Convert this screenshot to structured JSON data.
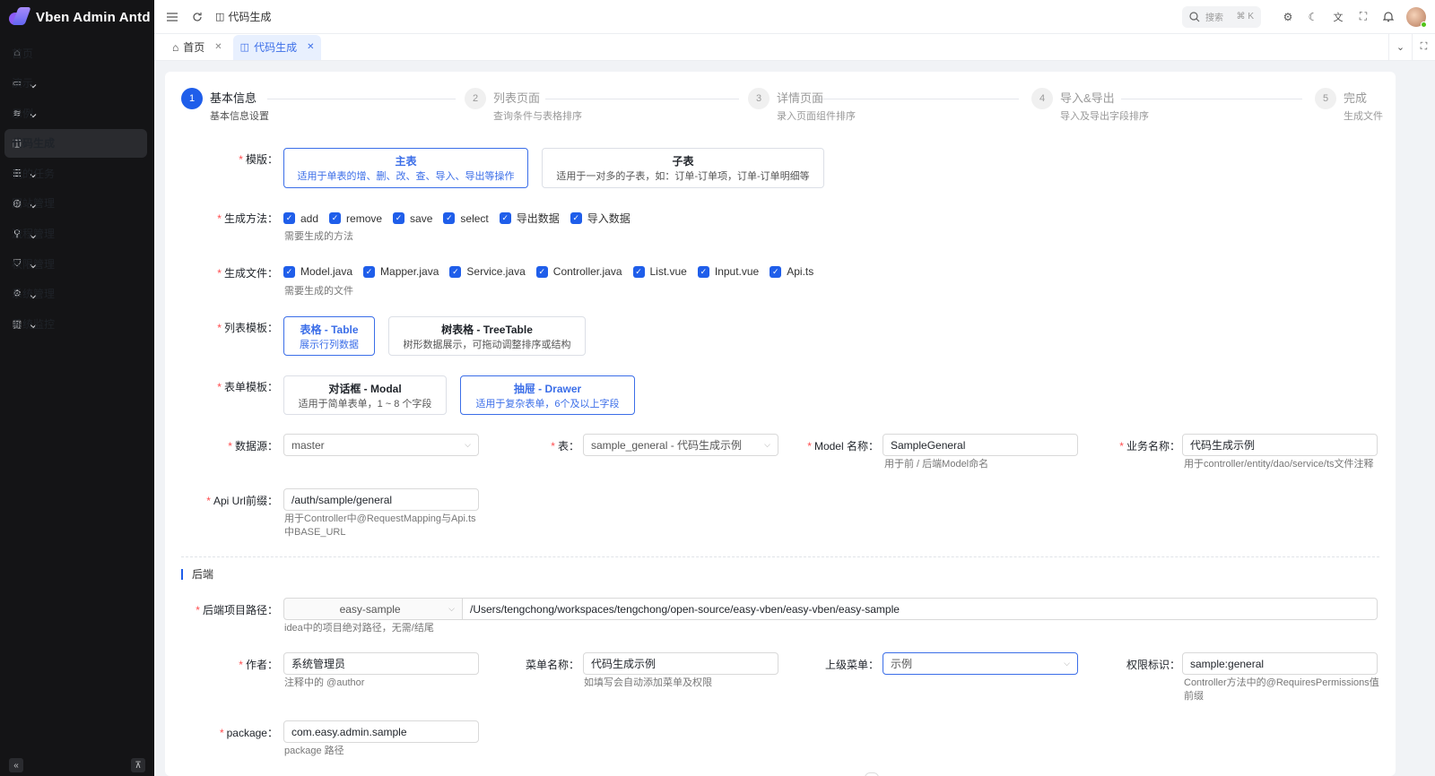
{
  "app": {
    "name": "Vben Admin Antd"
  },
  "sidebar": {
    "items": [
      {
        "label": "首页",
        "icon": "home-icon",
        "glyph": "⌂",
        "expandable": false,
        "active": false
      },
      {
        "label": "演示",
        "icon": "window-icon",
        "glyph": "▭",
        "expandable": true,
        "active": false
      },
      {
        "label": "示例",
        "icon": "layers-icon",
        "glyph": "≋",
        "expandable": true,
        "active": false
      },
      {
        "label": "代码生成",
        "icon": "code-icon",
        "glyph": "◫",
        "expandable": false,
        "active": true
      },
      {
        "label": "我的任务",
        "icon": "tasks-icon",
        "glyph": "☰",
        "expandable": true,
        "active": false
      },
      {
        "label": "网站管理",
        "icon": "globe-icon",
        "glyph": "◍",
        "expandable": true,
        "active": false
      },
      {
        "label": "流程管理",
        "icon": "workflow-icon",
        "glyph": "⚲",
        "expandable": true,
        "active": false
      },
      {
        "label": "权限管理",
        "icon": "shield-icon",
        "glyph": "⛉",
        "expandable": true,
        "active": false
      },
      {
        "label": "系统管理",
        "icon": "gear-icon",
        "glyph": "⚙",
        "expandable": true,
        "active": false
      },
      {
        "label": "系统监控",
        "icon": "chart-icon",
        "glyph": "▥",
        "expandable": true,
        "active": false
      }
    ]
  },
  "header": {
    "breadcrumb": "代码生成",
    "search_placeholder": "搜索",
    "search_shortcut": "⌘ K"
  },
  "tabs": [
    {
      "label": "首页",
      "active": false
    },
    {
      "label": "代码生成",
      "active": true
    }
  ],
  "steps": [
    {
      "num": "1",
      "title": "基本信息",
      "desc": "基本信息设置"
    },
    {
      "num": "2",
      "title": "列表页面",
      "desc": "查询条件与表格排序"
    },
    {
      "num": "3",
      "title": "详情页面",
      "desc": "录入页面组件排序"
    },
    {
      "num": "4",
      "title": "导入&导出",
      "desc": "导入及导出字段排序"
    },
    {
      "num": "5",
      "title": "完成",
      "desc": "生成文件"
    }
  ],
  "form": {
    "template": {
      "label": "模版",
      "options": [
        {
          "title": "主表",
          "desc": "适用于单表的增、删、改、查、导入、导出等操作",
          "selected": true
        },
        {
          "title": "子表",
          "desc": "适用于一对多的子表，如：订单-订单项，订单-订单明细等",
          "selected": false
        }
      ]
    },
    "methods": {
      "label": "生成方法",
      "items": [
        "add",
        "remove",
        "save",
        "select",
        "导出数据",
        "导入数据"
      ],
      "help": "需要生成的方法"
    },
    "files": {
      "label": "生成文件",
      "items": [
        "Model.java",
        "Mapper.java",
        "Service.java",
        "Controller.java",
        "List.vue",
        "Input.vue",
        "Api.ts"
      ],
      "help": "需要生成的文件"
    },
    "list_template": {
      "label": "列表模板",
      "options": [
        {
          "title": "表格 - Table",
          "desc": "展示行列数据",
          "selected": true
        },
        {
          "title": "树表格 - TreeTable",
          "desc": "树形数据展示，可拖动调整排序或结构",
          "selected": false
        }
      ]
    },
    "form_template": {
      "label": "表单模板",
      "options": [
        {
          "title": "对话框 - Modal",
          "desc": "适用于简单表单，1 ~ 8 个字段",
          "selected": false
        },
        {
          "title": "抽屉 - Drawer",
          "desc": "适用于复杂表单，6个及以上字段",
          "selected": true
        }
      ]
    },
    "datasource": {
      "label": "数据源",
      "value": "master"
    },
    "table": {
      "label": "表",
      "value": "sample_general - 代码生成示例"
    },
    "model_name": {
      "label": "Model 名称",
      "value": "SampleGeneral",
      "help": "用于前 / 后端Model命名"
    },
    "biz_name": {
      "label": "业务名称",
      "value": "代码生成示例",
      "help": "用于controller/entity/dao/service/ts文件注释"
    },
    "api_prefix": {
      "label": "Api Url前缀",
      "value": "/auth/sample/general",
      "help1": "用于Controller中@RequestMapping与Api.ts",
      "help2": "中BASE_URL"
    },
    "backend_section": "后端",
    "backend_path": {
      "label": "后端项目路径",
      "project": "easy-sample",
      "path": "/Users/tengchong/workspaces/tengchong/open-source/easy-vben/easy-vben/easy-sample",
      "help": "idea中的项目绝对路径，无需/结尾"
    },
    "author": {
      "label": "作者",
      "value": "系统管理员",
      "help": "注释中的 @author"
    },
    "menu_name": {
      "label": "菜单名称",
      "value": "代码生成示例",
      "help": "如填写会自动添加菜单及权限"
    },
    "parent_menu": {
      "label": "上级菜单",
      "value": "示例"
    },
    "permission": {
      "label": "权限标识",
      "value": "sample:general",
      "help1": "Controller方法中的@RequiresPermissions值",
      "help2": "前缀"
    },
    "package": {
      "label": "package",
      "value": "com.easy.admin.sample",
      "help": "package 路径"
    }
  },
  "colors": {
    "accent": "#1f5eea",
    "sidebar_bg": "#141416",
    "required": "#ff4d4f"
  }
}
